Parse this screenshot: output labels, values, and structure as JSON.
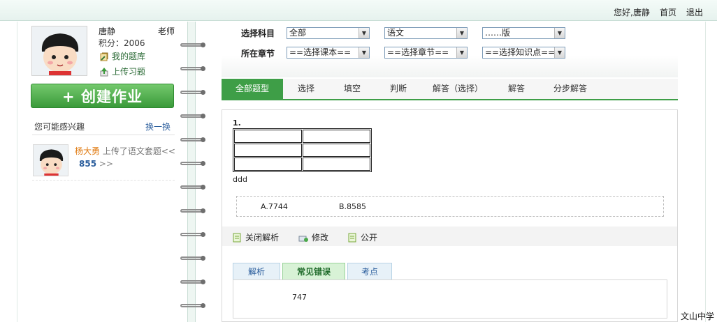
{
  "header": {
    "greeting": "您好,唐静",
    "home": "首页",
    "logout": "退出"
  },
  "user": {
    "name": "唐静",
    "role": "老师",
    "points": "积分：2006",
    "my_bank": "我的题库",
    "upload": "上传习题"
  },
  "create_button": "+ 创建作业",
  "interest": {
    "title": "您可能感兴趣",
    "swap": "换一换"
  },
  "feed": {
    "user": "杨大勇",
    "text": "上传了语文套题<<",
    "count": "855",
    "more": ">>"
  },
  "filters": {
    "subject_label": "选择科目",
    "chapter_label": "所在章节",
    "subject": "全部",
    "course": "语文",
    "version": "……版",
    "textbook": "==选择课本==",
    "chapter": "==选择章节==",
    "knowledge": "==选择知识点=="
  },
  "tabs": [
    "全部题型",
    "选择",
    "填空",
    "判断",
    "解答（选择）",
    "解答",
    "分步解答"
  ],
  "question": {
    "number": "1.",
    "text": "ddd",
    "option_a": "A.7744",
    "option_b": "B.8585"
  },
  "actions": {
    "close_analysis": "关闭解析",
    "edit": "修改",
    "public": "公开"
  },
  "subtabs": [
    "解析",
    "常见错误",
    "考点"
  ],
  "answer": "747",
  "school": "文山中学",
  "colors": {
    "accent": "#3e9e47",
    "link": "#2a5d9c",
    "highlight": "#e07a10"
  }
}
